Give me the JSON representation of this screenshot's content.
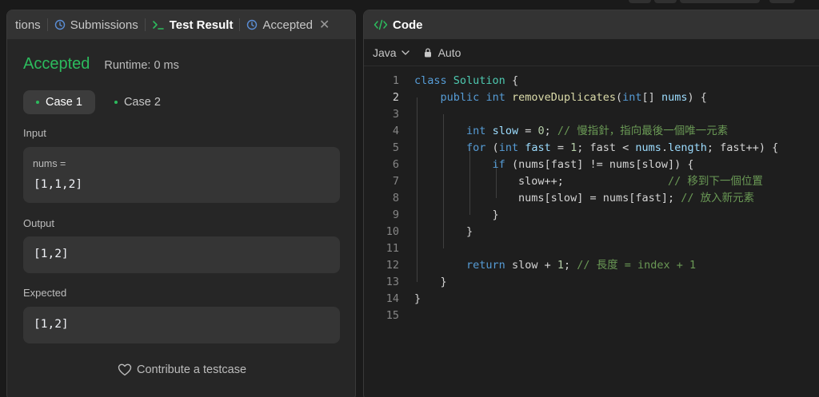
{
  "left_panel": {
    "tabs": [
      {
        "label": "tions",
        "icon": ""
      },
      {
        "label": "Submissions",
        "icon": "history-icon"
      },
      {
        "label": "Test Result",
        "icon": "terminal-icon"
      },
      {
        "label": "Accepted",
        "icon": "history-icon"
      }
    ],
    "tab_close": "✕",
    "status": "Accepted",
    "runtime": "Runtime: 0 ms",
    "cases": [
      "Case 1",
      "Case 2"
    ],
    "input_label": "Input",
    "input_var": "nums =",
    "input_value": "[1,1,2]",
    "output_label": "Output",
    "output_value": "[1,2]",
    "expected_label": "Expected",
    "expected_value": "[1,2]",
    "contribute": "Contribute a testcase"
  },
  "right_panel": {
    "title": "Code",
    "language": "Java",
    "mode": "Auto",
    "current_line": 2,
    "lines": [
      {
        "n": "1",
        "tokens": [
          [
            "kw",
            "class"
          ],
          [
            "pl",
            " "
          ],
          [
            "cls",
            "Solution"
          ],
          [
            "pl",
            " {"
          ]
        ]
      },
      {
        "n": "2",
        "tokens": [
          [
            "pl",
            "    "
          ],
          [
            "kw",
            "public"
          ],
          [
            "pl",
            " "
          ],
          [
            "ty",
            "int"
          ],
          [
            "pl",
            " "
          ],
          [
            "fn",
            "removeDuplicates"
          ],
          [
            "pl",
            "("
          ],
          [
            "ty",
            "int"
          ],
          [
            "pl",
            "[] "
          ],
          [
            "vr",
            "nums"
          ],
          [
            "pl",
            ") {"
          ]
        ]
      },
      {
        "n": "3",
        "tokens": []
      },
      {
        "n": "4",
        "tokens": [
          [
            "pl",
            "        "
          ],
          [
            "ty",
            "int"
          ],
          [
            "pl",
            " "
          ],
          [
            "vr",
            "slow"
          ],
          [
            "pl",
            " = "
          ],
          [
            "nm",
            "0"
          ],
          [
            "pl",
            "; "
          ],
          [
            "cm",
            "// 慢指針，指向最後一個唯一元素"
          ]
        ]
      },
      {
        "n": "5",
        "tokens": [
          [
            "pl",
            "        "
          ],
          [
            "kw",
            "for"
          ],
          [
            "pl",
            " ("
          ],
          [
            "ty",
            "int"
          ],
          [
            "pl",
            " "
          ],
          [
            "vr",
            "fast"
          ],
          [
            "pl",
            " = "
          ],
          [
            "nm",
            "1"
          ],
          [
            "pl",
            "; fast < "
          ],
          [
            "vr",
            "nums"
          ],
          [
            "pl",
            "."
          ],
          [
            "vr",
            "length"
          ],
          [
            "pl",
            "; fast++) {"
          ]
        ]
      },
      {
        "n": "6",
        "tokens": [
          [
            "pl",
            "            "
          ],
          [
            "kw",
            "if"
          ],
          [
            "pl",
            " (nums[fast] != nums[slow]) {"
          ]
        ]
      },
      {
        "n": "7",
        "tokens": [
          [
            "pl",
            "                slow++;                "
          ],
          [
            "cm",
            "// 移到下一個位置"
          ]
        ]
      },
      {
        "n": "8",
        "tokens": [
          [
            "pl",
            "                nums[slow] = nums[fast]; "
          ],
          [
            "cm",
            "// 放入新元素"
          ]
        ]
      },
      {
        "n": "9",
        "tokens": [
          [
            "pl",
            "            }"
          ]
        ]
      },
      {
        "n": "10",
        "tokens": [
          [
            "pl",
            "        }"
          ]
        ]
      },
      {
        "n": "11",
        "tokens": []
      },
      {
        "n": "12",
        "tokens": [
          [
            "pl",
            "        "
          ],
          [
            "kw",
            "return"
          ],
          [
            "pl",
            " slow + "
          ],
          [
            "nm",
            "1"
          ],
          [
            "pl",
            "; "
          ],
          [
            "cm",
            "// 長度 = index + 1"
          ]
        ]
      },
      {
        "n": "13",
        "tokens": [
          [
            "pl",
            "    }"
          ]
        ]
      },
      {
        "n": "14",
        "tokens": [
          [
            "pl",
            "}"
          ]
        ]
      },
      {
        "n": "15",
        "tokens": []
      }
    ]
  },
  "colors": {
    "accepted": "#2cbb5d",
    "panel_bg": "#262626",
    "editor_bg": "#1e1e1e"
  }
}
